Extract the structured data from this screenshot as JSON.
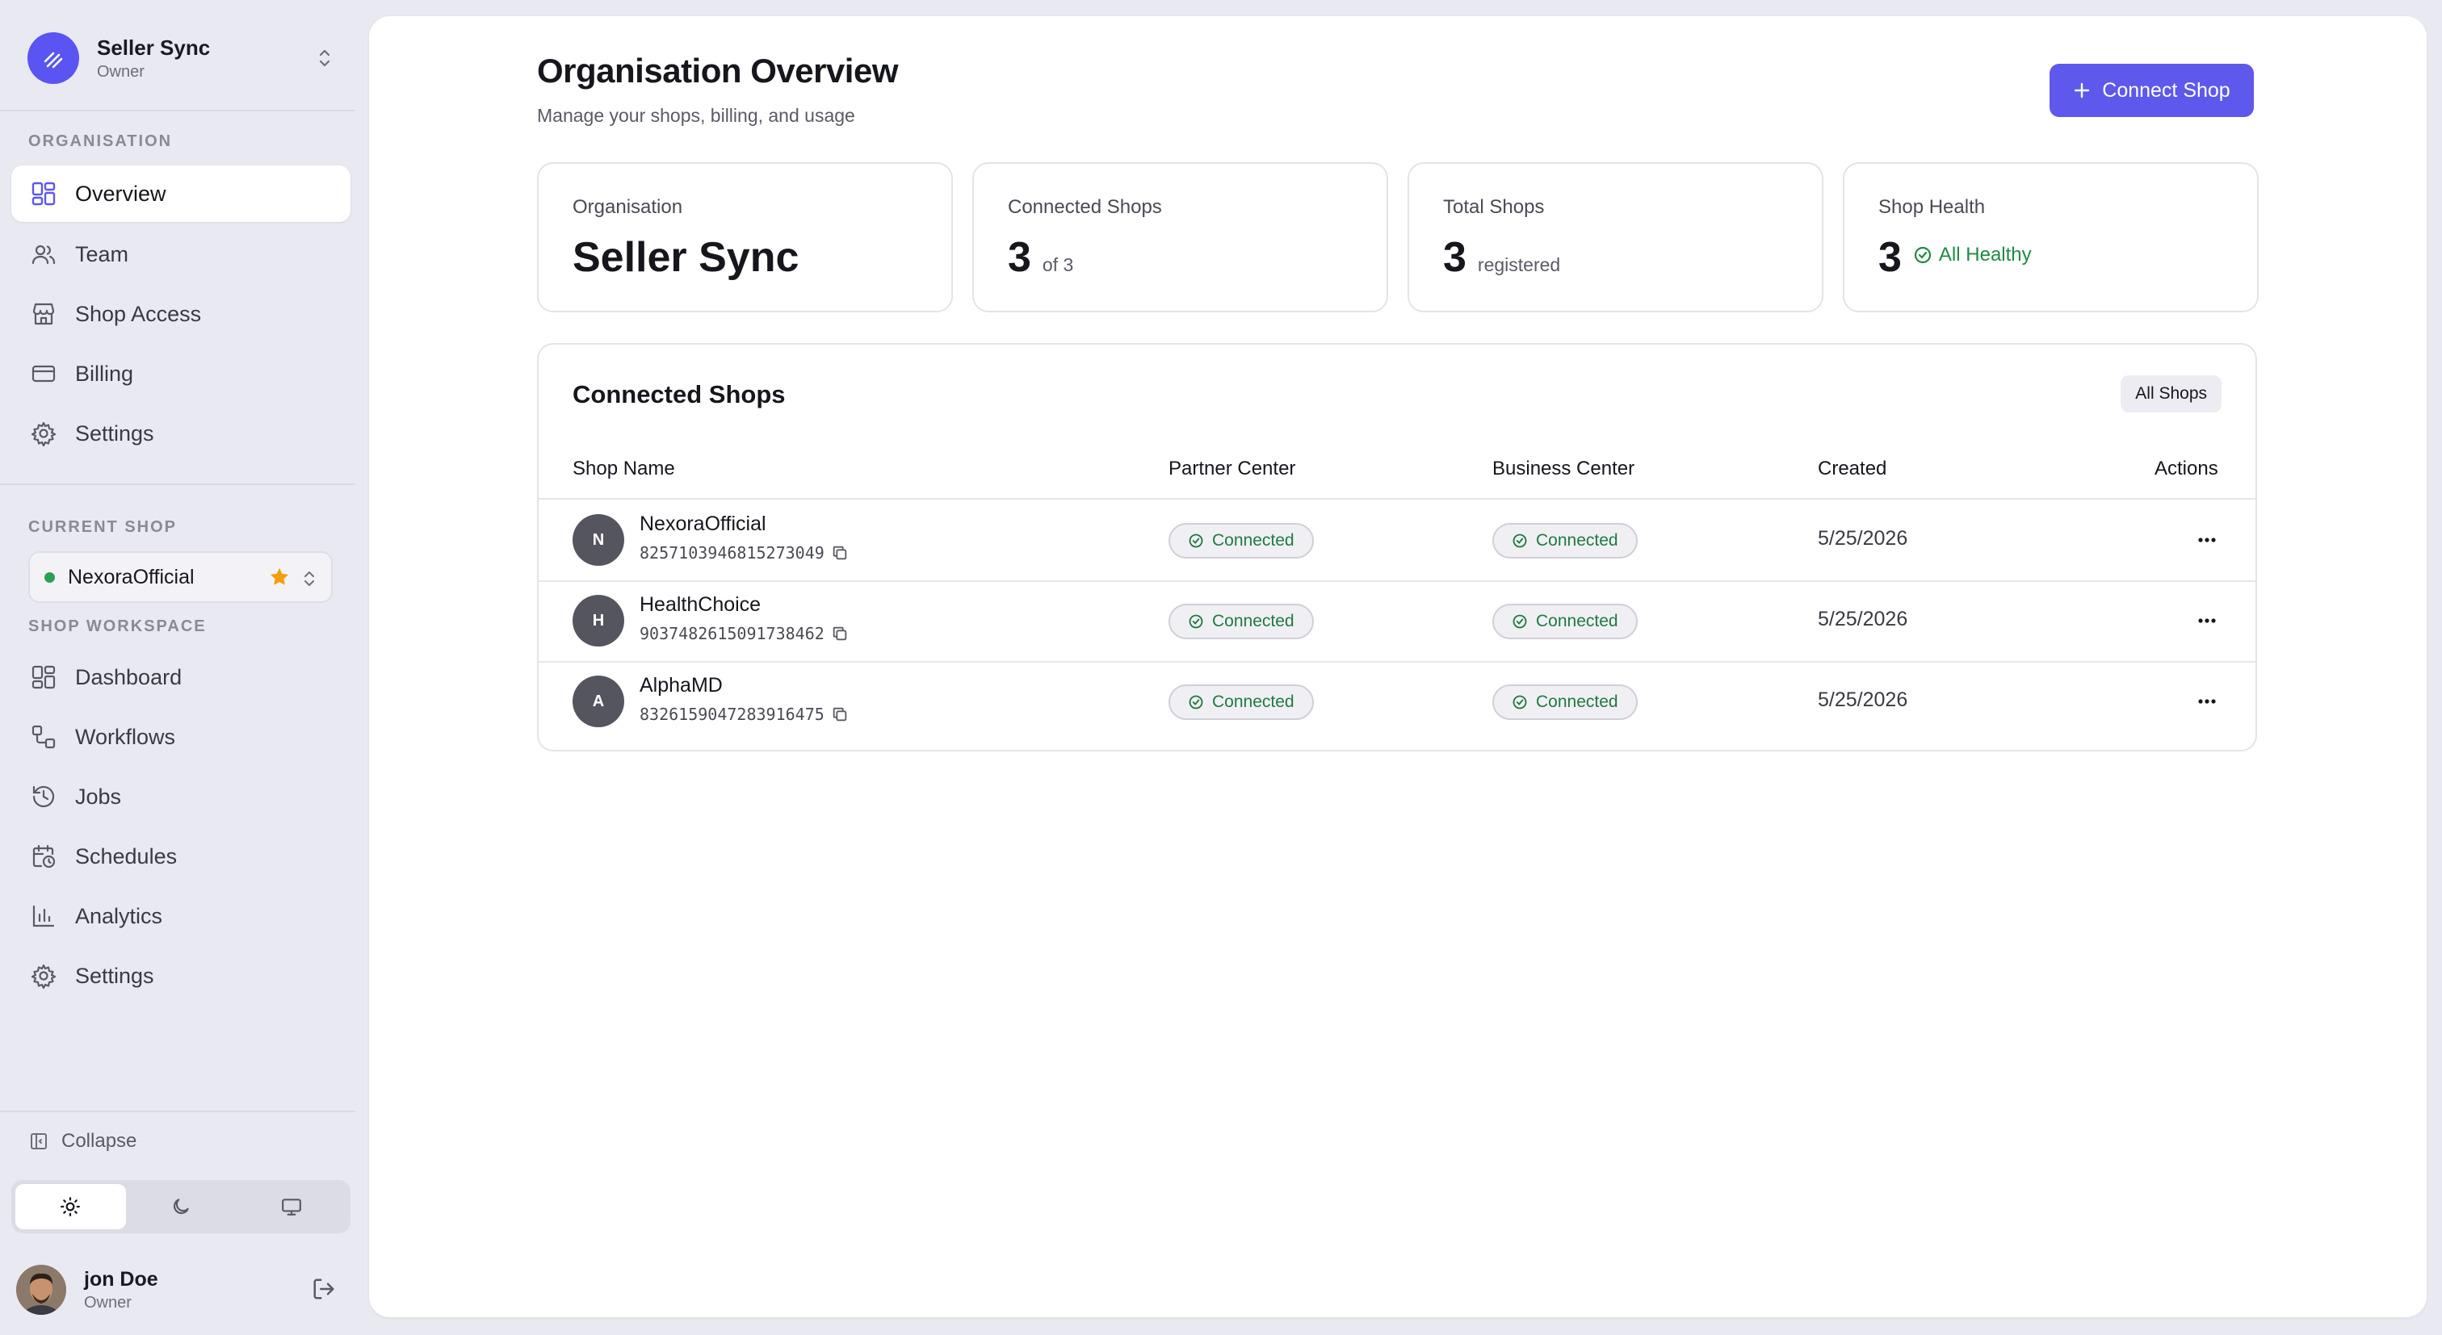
{
  "org": {
    "name": "Seller Sync",
    "role": "Owner"
  },
  "sidebar": {
    "organisation_label": "ORGANISATION",
    "org_items": [
      {
        "label": "Overview",
        "icon": "layout-grid-icon",
        "active": true
      },
      {
        "label": "Team",
        "icon": "users-icon"
      },
      {
        "label": "Shop Access",
        "icon": "store-icon"
      },
      {
        "label": "Billing",
        "icon": "credit-card-icon"
      },
      {
        "label": "Settings",
        "icon": "gear-icon"
      }
    ],
    "current_shop_label": "CURRENT SHOP",
    "current_shop": "NexoraOfficial",
    "workspace_label": "SHOP WORKSPACE",
    "workspace_items": [
      {
        "label": "Dashboard",
        "icon": "layout-grid-icon"
      },
      {
        "label": "Workflows",
        "icon": "workflow-icon"
      },
      {
        "label": "Jobs",
        "icon": "history-icon"
      },
      {
        "label": "Schedules",
        "icon": "calendar-clock-icon"
      },
      {
        "label": "Analytics",
        "icon": "bar-chart-icon"
      },
      {
        "label": "Settings",
        "icon": "gear-icon"
      }
    ],
    "collapse_label": "Collapse",
    "theme_options": [
      "light",
      "dark",
      "system"
    ],
    "theme_selected": "light"
  },
  "user": {
    "name": "jon Doe",
    "role": "Owner"
  },
  "page": {
    "title": "Organisation Overview",
    "subtitle": "Manage your shops, billing, and usage",
    "connect_button": "Connect Shop"
  },
  "stats": {
    "organisation": {
      "label": "Organisation",
      "value": "Seller Sync"
    },
    "connected": {
      "label": "Connected Shops",
      "value": "3",
      "sub": "of 3"
    },
    "total": {
      "label": "Total Shops",
      "value": "3",
      "sub": "registered"
    },
    "health": {
      "label": "Shop Health",
      "value": "3",
      "sub": "All Healthy"
    }
  },
  "table": {
    "title": "Connected Shops",
    "filter_button": "All Shops",
    "headers": {
      "shop_name": "Shop Name",
      "partner_center": "Partner Center",
      "business_center": "Business Center",
      "created": "Created",
      "actions": "Actions"
    },
    "rows": [
      {
        "initial": "N",
        "name": "NexoraOfficial",
        "id": "8257103946815273049",
        "partner": "Connected",
        "business": "Connected",
        "created": "5/25/2026"
      },
      {
        "initial": "H",
        "name": "HealthChoice",
        "id": "9037482615091738462",
        "partner": "Connected",
        "business": "Connected",
        "created": "5/25/2026"
      },
      {
        "initial": "A",
        "name": "AlphaMD",
        "id": "8326159047283916475",
        "partner": "Connected",
        "business": "Connected",
        "created": "5/25/2026"
      }
    ]
  },
  "colors": {
    "accent": "#5e58ec",
    "success": "#1f8a45",
    "sidebar_bg": "#e9e9f1",
    "star": "#f59e0b"
  }
}
